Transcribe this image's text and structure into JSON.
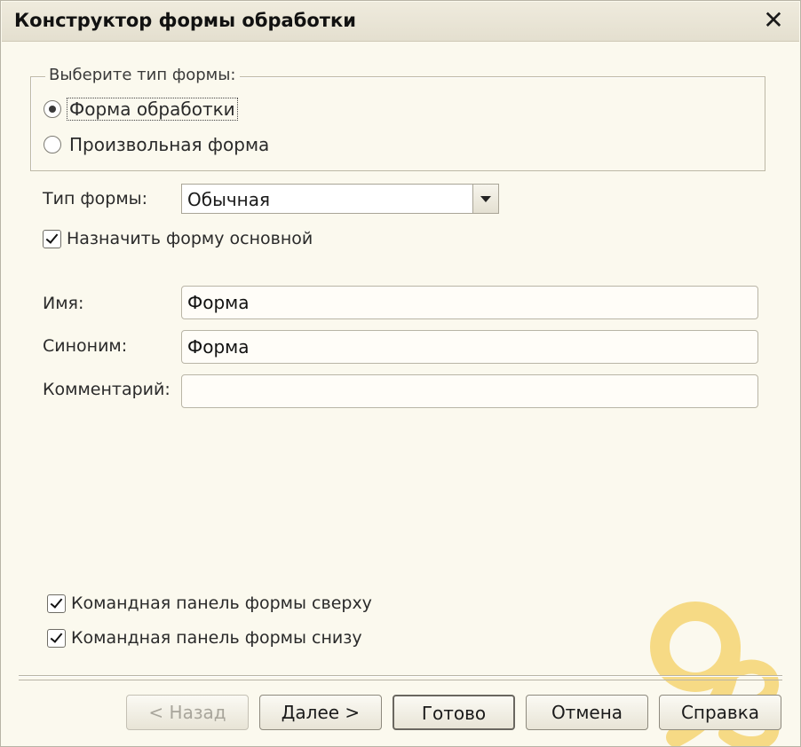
{
  "window": {
    "title": "Конструктор формы обработки"
  },
  "form_type_group": {
    "legend": "Выберите тип формы:",
    "options": [
      {
        "label": "Форма обработки",
        "selected": true
      },
      {
        "label": "Произвольная форма",
        "selected": false
      }
    ]
  },
  "form_kind": {
    "label": "Тип формы:",
    "value": "Обычная"
  },
  "set_main_form": {
    "label": "Назначить форму основной",
    "checked": true
  },
  "fields": {
    "name_label": "Имя:",
    "name_value": "Форма",
    "synonym_label": "Синоним:",
    "synonym_value": "Форма",
    "comment_label": "Комментарий:",
    "comment_value": ""
  },
  "command_panel": {
    "top_label": "Командная панель формы сверху",
    "top_checked": true,
    "bottom_label": "Командная панель формы снизу",
    "bottom_checked": true
  },
  "buttons": {
    "back": "< Назад",
    "next": "Далее >",
    "done": "Готово",
    "cancel": "Отмена",
    "help": "Справка"
  },
  "colors": {
    "background": "#fbf9ee",
    "watermark": "#f2c230"
  }
}
